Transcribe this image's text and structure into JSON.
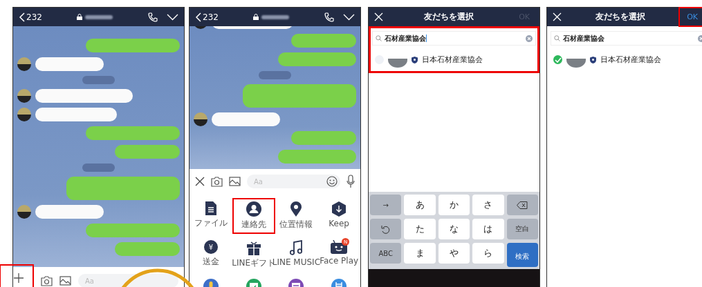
{
  "screens": [
    {
      "kind": "chat",
      "back_label": "232",
      "input_placeholder": "Aa",
      "plus_highlighted": true,
      "messages": [
        {
          "kind": "sent"
        },
        {
          "kind": "received"
        },
        {
          "kind": "date"
        },
        {
          "kind": "received"
        },
        {
          "kind": "received"
        },
        {
          "kind": "sent"
        },
        {
          "kind": "sent"
        },
        {
          "kind": "date"
        },
        {
          "kind": "sent_long"
        },
        {
          "kind": "received"
        },
        {
          "kind": "sent"
        },
        {
          "kind": "sent"
        }
      ]
    },
    {
      "kind": "chat_menu",
      "back_label": "232",
      "input_placeholder": "Aa",
      "messages": [
        {
          "kind": "received"
        },
        {
          "kind": "sent"
        },
        {
          "kind": "sent"
        },
        {
          "kind": "date"
        },
        {
          "kind": "sent_long"
        },
        {
          "kind": "received"
        },
        {
          "kind": "sent"
        },
        {
          "kind": "sent"
        }
      ],
      "menu": [
        {
          "label": "ファイル",
          "highlighted": false
        },
        {
          "label": "連絡先",
          "highlighted": true
        },
        {
          "label": "位置情報",
          "highlighted": false
        },
        {
          "label": "Keep",
          "highlighted": false
        },
        {
          "glyph": "¥",
          "label": "送金",
          "highlighted": false
        },
        {
          "label": "LINEギフト",
          "highlighted": false
        },
        {
          "label": "LINE MUSIC",
          "highlighted": false
        },
        {
          "label": "Face Play",
          "badge": "N",
          "highlighted": false
        },
        {
          "highlighted": false
        },
        {
          "highlighted": false
        },
        {
          "highlighted": false
        },
        {
          "highlighted": false
        }
      ]
    },
    {
      "kind": "friend_select",
      "title": "友だちを選択",
      "ok_label": "OK",
      "ok_enabled": false,
      "ok_highlighted": false,
      "search_value": "石材産業協会",
      "search_highlighted": true,
      "results": [
        {
          "name": "日本石材産業協会",
          "checked": false
        }
      ],
      "keyboard": [
        [
          {
            "kind": "function",
            "label": "→"
          },
          {
            "kind": "char",
            "label": "あ"
          },
          {
            "kind": "char",
            "label": "か"
          },
          {
            "kind": "char",
            "label": "さ"
          },
          {
            "kind": "delete"
          }
        ],
        [
          {
            "kind": "undo"
          },
          {
            "kind": "char",
            "label": "た"
          },
          {
            "kind": "char",
            "label": "な"
          },
          {
            "kind": "char",
            "label": "は"
          },
          {
            "kind": "function",
            "label": "空白"
          }
        ],
        [
          {
            "kind": "function",
            "label": "ABC"
          },
          {
            "kind": "char",
            "label": "ま"
          },
          {
            "kind": "char",
            "label": "や"
          },
          {
            "kind": "char",
            "label": "ら"
          },
          {
            "kind": "action",
            "label": "検索"
          }
        ]
      ]
    },
    {
      "kind": "friend_select",
      "title": "友だちを選択",
      "ok_label": "OK",
      "ok_enabled": true,
      "ok_highlighted": true,
      "search_value": "石材産業協会",
      "search_highlighted": false,
      "results": [
        {
          "name": "日本石材産業協会",
          "checked": true
        }
      ]
    }
  ]
}
